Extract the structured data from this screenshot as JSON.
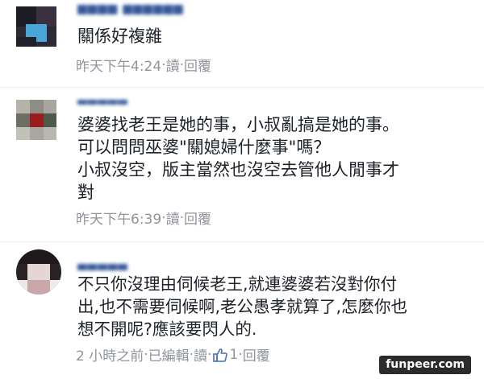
{
  "comments": [
    {
      "text_lines": [
        "關係好複雜"
      ],
      "meta": {
        "time": "昨天下午4:24",
        "sep": " · ",
        "reply_label": "讀",
        "reply2_label": "回覆"
      }
    },
    {
      "text_lines": [
        "婆婆找老王是她的事，小叔亂搞是她的事。",
        "可以問問巫婆\"關媳婦什麼事\"嗎？",
        "小叔沒空，版主當然也沒空去管他人閒事才",
        "對"
      ],
      "meta": {
        "time": "昨天下午6:39",
        "sep": " · ",
        "reply_label": "讀",
        "reply2_label": "回覆"
      }
    },
    {
      "text_lines": [
        "不只你沒理由伺候老王,就連婆婆若沒對你付",
        "出,也不需要伺候啊,老公愚孝就算了,怎麼你也",
        "想不開呢?應該要閃人的."
      ],
      "meta": {
        "time": "2 小時之前",
        "edited": "已編輯",
        "reply_label": "讀",
        "like_count": "1",
        "reply2_label": "回覆",
        "sep": " · "
      }
    }
  ],
  "watermark": "funpeer.com",
  "colors": {
    "name": "#365899",
    "text": "#1d2129",
    "meta": "#90949c",
    "separator": "#e9ebee"
  }
}
